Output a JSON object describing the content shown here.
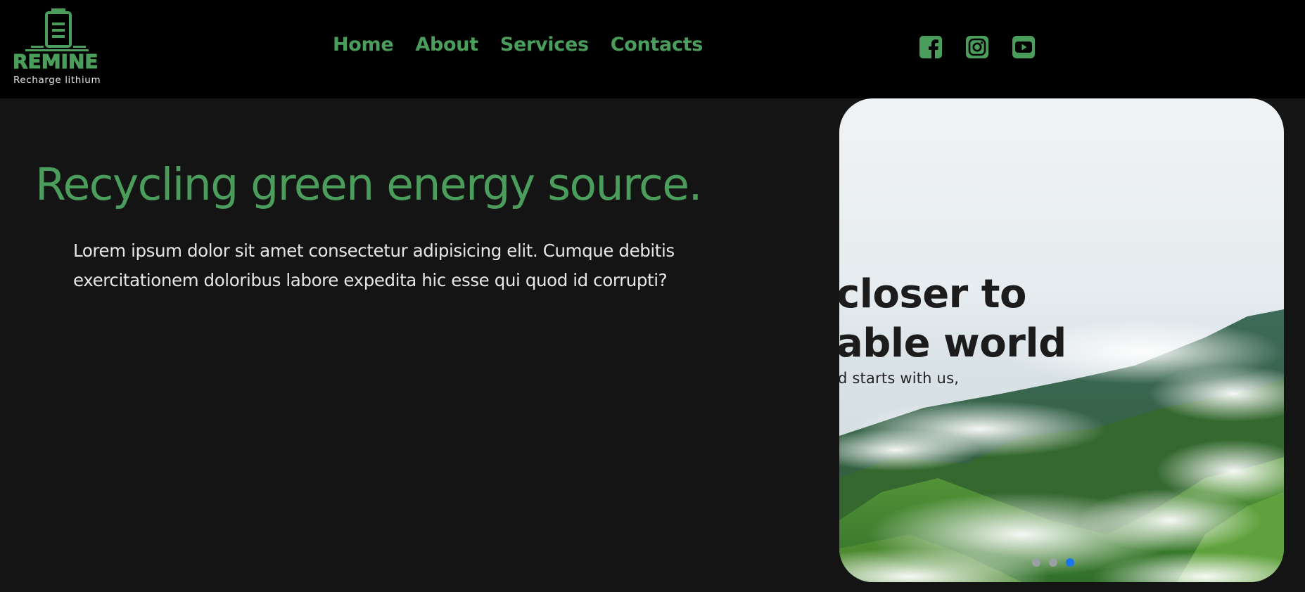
{
  "brand": {
    "name": "REMINE",
    "tagline": "Recharge lithium",
    "color": "#4a9d5b"
  },
  "nav": {
    "items": [
      "Home",
      "About",
      "Services",
      "Contacts"
    ]
  },
  "socials": {
    "icons": [
      "facebook-icon",
      "instagram-icon",
      "youtube-icon"
    ]
  },
  "hero": {
    "title": "Recycling green energy source.",
    "text": "Lorem ipsum dolor sit amet consectetur adipisicing elit. Cumque debitis exercitationem doloribus labore expedita hic esse qui quod id corrupti?"
  },
  "carousel": {
    "heading_line1": "closer to",
    "heading_line2": "able world",
    "subtext": "d starts with us,",
    "slide_count": 3,
    "active_slide": 3,
    "active_color": "#1976f2"
  }
}
